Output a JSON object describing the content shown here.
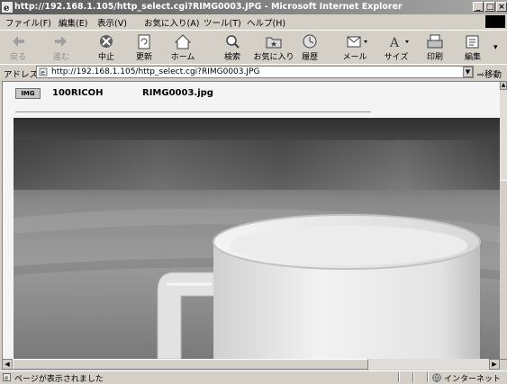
{
  "window": {
    "title": "http://192.168.1.105/http_select.cgi?RIMG0003.JPG - Microsoft Internet Explorer"
  },
  "menu": [
    "ファイル(F)",
    "編集(E)",
    "表示(V)",
    "お気に入り(A)",
    "ツール(T)",
    "ヘルプ(H)"
  ],
  "toolbar": {
    "back": "戻る",
    "forward": "進む",
    "stop": "中止",
    "refresh": "更新",
    "home": "ホーム",
    "search": "検索",
    "favorites": "お気に入り",
    "history": "履歴",
    "mail": "メール",
    "size": "サイズ",
    "print": "印刷",
    "edit": "編集"
  },
  "address": {
    "label": "アドレス(D)",
    "url": "http://192.168.1.105/http_select.cgi?RIMG0003.JPG",
    "go": "移動"
  },
  "page": {
    "icon_text": "IMG",
    "folder": "100RICOH",
    "filename": "RIMG0003.jpg"
  },
  "status": {
    "text": "ページが表示されました",
    "zone": "インターネット"
  }
}
